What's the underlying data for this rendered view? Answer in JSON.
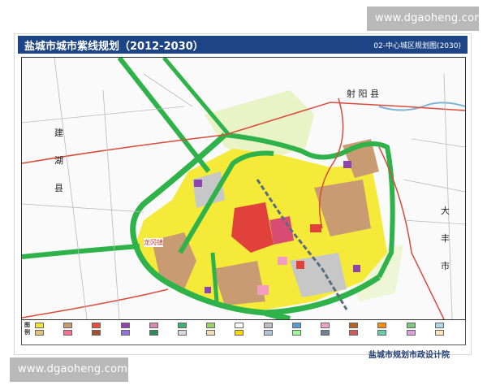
{
  "watermark": {
    "top": "www.dgaoheng.com",
    "bottom": "www.dgaoheng.com"
  },
  "title": {
    "main": "盐城市城市紫线规划（2012-2030）",
    "sub": "02-中心城区规划图(2030)"
  },
  "map_labels": {
    "north_county": "射 阳 县",
    "west_county": [
      "建",
      "湖",
      "县"
    ],
    "east_county": [
      "大",
      "丰",
      "市"
    ],
    "town": "龙冈镇"
  },
  "legend": {
    "title": "图 例",
    "items": [
      {
        "color": "#f2e43a"
      },
      {
        "color": "#c79a6b"
      },
      {
        "color": "#e74c3c"
      },
      {
        "color": "#8e44ad"
      },
      {
        "color": "#d98ab0"
      },
      {
        "color": "#3cb371"
      },
      {
        "color": "#9bd36a"
      },
      {
        "color": "#ffffff"
      },
      {
        "color": "#c0c0c0"
      },
      {
        "color": "#5b9bd5"
      },
      {
        "color": "#f3a3c8"
      },
      {
        "color": "#b5651d"
      },
      {
        "color": "#ff8c00"
      },
      {
        "color": "#7fc97f"
      },
      {
        "color": "#add8e6"
      },
      {
        "color": "#e0c27a"
      },
      {
        "color": "#ff6f91"
      },
      {
        "color": "#a0522d"
      },
      {
        "color": "#9370db"
      },
      {
        "color": "#2e8b57"
      },
      {
        "color": "#d9d9d9"
      },
      {
        "color": "#f5deb3"
      },
      {
        "color": "#ffd700"
      },
      {
        "color": "#b0c4de"
      },
      {
        "color": "#98fb98"
      },
      {
        "color": "#708090"
      },
      {
        "color": "#cd5c5c"
      },
      {
        "color": "#66cdaa"
      },
      {
        "color": "#dda0dd"
      },
      {
        "color": "#ffe4b5"
      }
    ]
  },
  "institute": "盐城市规划市政设计院"
}
